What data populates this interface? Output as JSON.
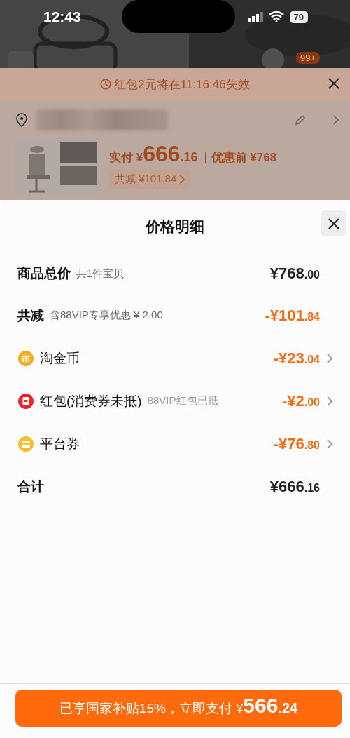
{
  "status_bar": {
    "time": "12:43",
    "battery": "79"
  },
  "background": {
    "badge": "99+"
  },
  "order_panel": {
    "notice": "红包2元将在11:16:46失效",
    "paid_label": "实付",
    "paid_currency": "¥",
    "paid_main": "666",
    "paid_decimal": ".16",
    "original_price": "优惠前 ¥768",
    "discount_tag": "共减 ¥101.84"
  },
  "sheet": {
    "title": "价格明细",
    "rows": [
      {
        "kind": "summary",
        "label": "商品总价",
        "note": "共1件宝贝",
        "amount_main": "¥768",
        "amount_decimal": ".00",
        "discount": false,
        "has_detail": false
      },
      {
        "kind": "summary",
        "label": "共减",
        "note": "含88VIP专享优惠 ¥ 2.00",
        "amount_main": "-¥101",
        "amount_decimal": ".84",
        "discount": true,
        "has_detail": false
      },
      {
        "kind": "coin",
        "label": "淘金币",
        "amount_main": "-¥23",
        "amount_decimal": ".04",
        "discount": true,
        "has_detail": true
      },
      {
        "kind": "red-packet",
        "label": "红包(消费券未抵)",
        "note": "88VIP红包已抵",
        "amount_main": "-¥2",
        "amount_decimal": ".00",
        "discount": true,
        "has_detail": true
      },
      {
        "kind": "coupon",
        "label": "平台券",
        "amount_main": "-¥76",
        "amount_decimal": ".80",
        "discount": true,
        "has_detail": true
      },
      {
        "kind": "summary",
        "label": "合计",
        "amount_main": "¥666",
        "amount_decimal": ".16",
        "discount": false,
        "has_detail": false
      }
    ]
  },
  "pay_button": {
    "label": "已享国家补贴15%，立即支付",
    "currency": "¥",
    "main": "566",
    "decimal": ".24"
  }
}
